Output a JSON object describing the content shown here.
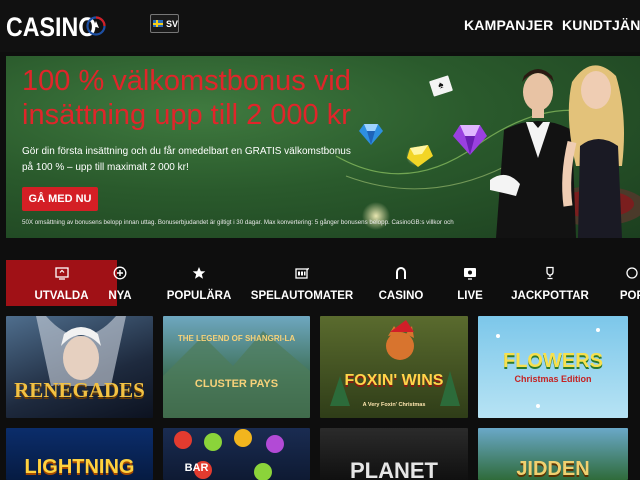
{
  "header": {
    "logo_text": "CASINO",
    "lang_code": "SV",
    "nav": [
      {
        "label": "KAMPANJER"
      },
      {
        "label": "KUNDTJÄNST"
      }
    ]
  },
  "banner": {
    "title": "100 % välkomstbonus vid insättning upp till 2 000 kr",
    "subtitle": "Gör din första insättning och du får omedelbart en GRATIS välkomstbonus på 100 % – upp till maximalt 2 000 kr!",
    "cta": "GÅ MED NU",
    "terms": "50X omsättning av bonusens belopp innan uttag. Bonuserbjudandet är giltigt i 30 dagar. Max konvertering: 5 gånger bonusens belopp. CasinoGB:s villkor och"
  },
  "categories": [
    {
      "label": "UTVALDA",
      "icon": "featured-icon",
      "active": true
    },
    {
      "label": "NYA",
      "icon": "plus-circle-icon",
      "active": false
    },
    {
      "label": "POPULÄRA",
      "icon": "star-icon",
      "active": false
    },
    {
      "label": "SPELAUTOMATER",
      "icon": "slot-machine-icon",
      "active": false
    },
    {
      "label": "CASINO",
      "icon": "horseshoe-icon",
      "active": false
    },
    {
      "label": "LIVE",
      "icon": "live-icon",
      "active": false
    },
    {
      "label": "JACKPOTTAR",
      "icon": "trophy-icon",
      "active": false
    },
    {
      "label": "POP",
      "icon": "misc-icon",
      "active": false
    }
  ],
  "games": [
    {
      "title": "RENEGADES"
    },
    {
      "title": "THE LEGEND OF SHANGRI-LA",
      "subtitle": "CLUSTER PAYS"
    },
    {
      "title": "FOXIN' WINS",
      "subtitle": "A Very Foxin' Christmas"
    },
    {
      "title": "FLOWERS",
      "subtitle": "Christmas Edition"
    },
    {
      "title": "LIGHTNING"
    },
    {
      "title": "BAR"
    },
    {
      "title": "PLANET"
    },
    {
      "title": "JIDDEN"
    }
  ],
  "colors": {
    "accent_red": "#d41f25",
    "active_tab": "#a01116",
    "banner_green": "#2a5a2c"
  }
}
